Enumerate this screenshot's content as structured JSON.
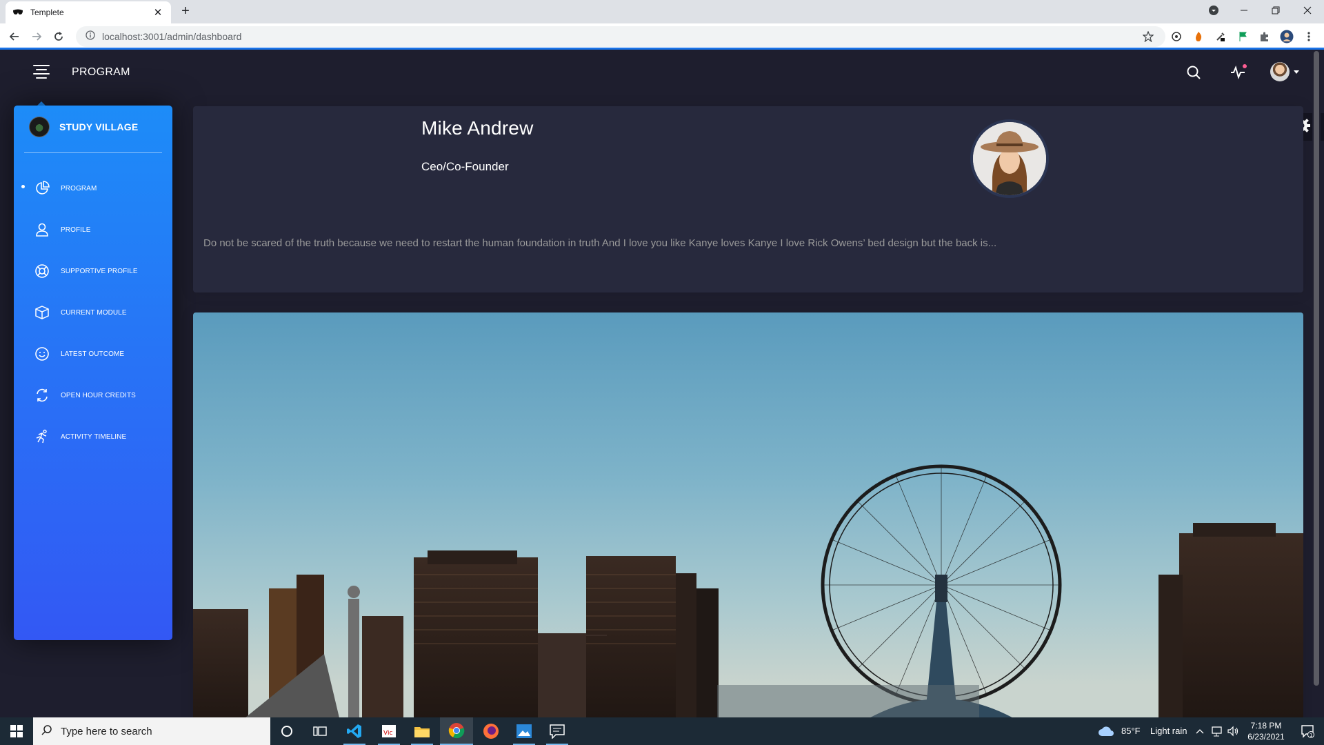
{
  "browser": {
    "tab_title": "Templete",
    "url": "localhost:3001/admin/dashboard"
  },
  "app": {
    "page_title": "PROGRAM",
    "brand": "STUDY VILLAGE",
    "menu": [
      {
        "label": "PROGRAM",
        "icon": "chart-pie-icon",
        "active": true
      },
      {
        "label": "PROFILE",
        "icon": "user-icon",
        "active": false
      },
      {
        "label": "SUPPORTIVE PROFILE",
        "icon": "life-ring-icon",
        "active": false
      },
      {
        "label": "CURRENT MODULE",
        "icon": "box-icon",
        "active": false
      },
      {
        "label": "LATEST OUTCOME",
        "icon": "smile-icon",
        "active": false
      },
      {
        "label": "OPEN HOUR CREDITS",
        "icon": "refresh-icon",
        "active": false
      },
      {
        "label": "ACTIVITY TIMELINE",
        "icon": "running-icon",
        "active": false
      }
    ]
  },
  "profile": {
    "name": "Mike Andrew",
    "role": "Ceo/Co-Founder",
    "bio": "Do not be scared of the truth because we need to restart the human foundation in truth And I love you like Kanye loves Kanye I love Rick Owens’ bed design but the back is..."
  },
  "taskbar": {
    "search_placeholder": "Type here to search",
    "weather_temp": "85°F",
    "weather_desc": "Light rain",
    "time": "7:18 PM",
    "date": "6/23/2021"
  },
  "colors": {
    "sidebar_top": "#1d8cf8",
    "sidebar_bottom": "#3358f4",
    "app_bg": "#1e1e2e",
    "card_bg": "#27293d",
    "notification_dot": "#fd5d93"
  }
}
